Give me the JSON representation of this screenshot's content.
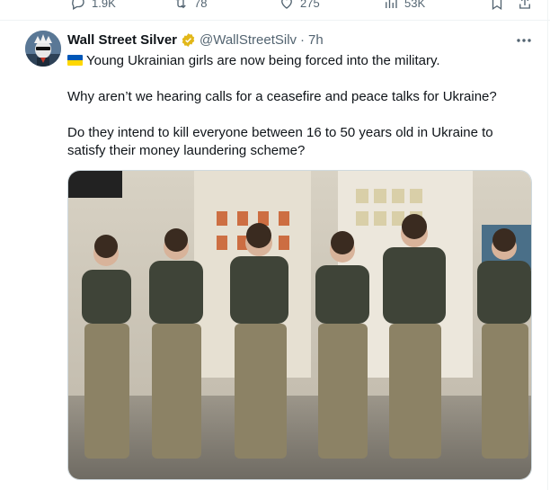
{
  "prev_tweet_actions": {
    "replies": "1.9K",
    "retweets": "78",
    "likes": "275",
    "views": "53K"
  },
  "tweet": {
    "author_name": "Wall Street Silver",
    "verified": true,
    "handle": "@WallStreetSilv",
    "separator": "·",
    "time": "7h",
    "line1": "Young Ukrainian girls are now being forced into the military.",
    "line2": "Why aren’t we hearing calls for a ceasefire and peace talks for Ukraine?",
    "line3": "Do they intend to kill everyone between 16 to 50 years old in Ukraine to satisfy their money laundering scheme?",
    "flag_colors": [
      "#0057b7",
      "#ffd700"
    ]
  },
  "icons": [
    "reply-icon",
    "retweet-icon",
    "like-icon",
    "views-icon",
    "bookmark-icon",
    "share-icon",
    "more-icon",
    "verified-badge-icon",
    "ukraine-flag-icon"
  ],
  "colors": {
    "secondary_text": "#536471",
    "gold_badge": "#e2b719",
    "border": "#cfd9de"
  }
}
